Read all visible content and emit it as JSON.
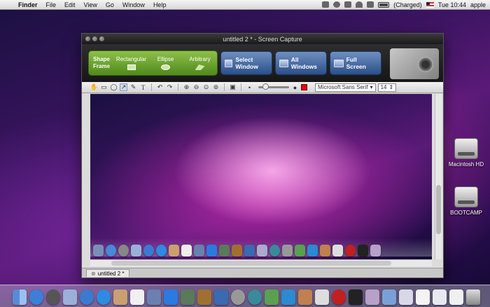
{
  "menubar": {
    "app_name": "Finder",
    "items": [
      "File",
      "Edit",
      "View",
      "Go",
      "Window",
      "Help"
    ],
    "battery_status": "(Charged)",
    "clock": "Tue 10:44",
    "user": "apple"
  },
  "window": {
    "title": "untitled 2 * - Screen Capture",
    "shape_frame_label": "Shape Frame",
    "shapes": [
      "Rectangular",
      "Ellipse",
      "Arbitrary"
    ],
    "buttons": [
      "Select Window",
      "All Windows",
      "Full Screen"
    ],
    "font_name": "Microsoft Sans Serif",
    "font_size": "14",
    "tab_label": "untitled 2 *"
  },
  "desktop": {
    "icons": [
      "Macintosh HD",
      "BOOTCAMP"
    ]
  },
  "colors": {
    "accent_green": "#5f9a28",
    "button_blue": "#3b5f99",
    "draw_color": "#e00000"
  }
}
